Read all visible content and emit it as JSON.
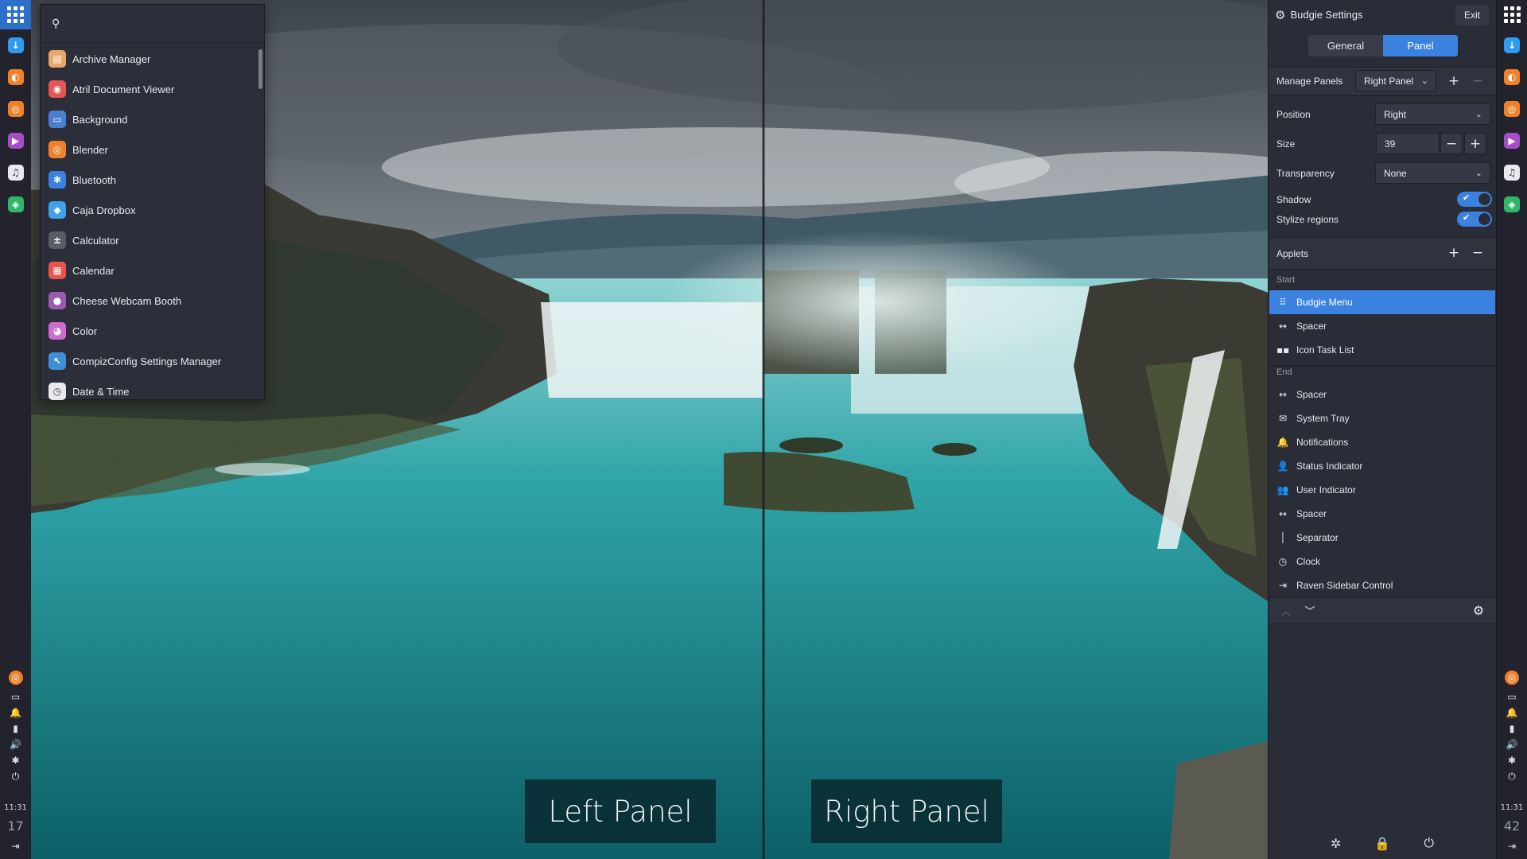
{
  "menu": {
    "search_placeholder": "",
    "items": [
      {
        "label": "Archive Manager",
        "icon": "archive-manager-icon",
        "color": "#e8a86a",
        "glyph": "▤"
      },
      {
        "label": "Atril Document Viewer",
        "icon": "atril-document-viewer-icon",
        "color": "#e25656",
        "glyph": "◉"
      },
      {
        "label": "Background",
        "icon": "background-icon",
        "color": "#4a7fd0",
        "glyph": "▭"
      },
      {
        "label": "Blender",
        "icon": "blender-icon",
        "color": "#f0812a",
        "glyph": "◎"
      },
      {
        "label": "Bluetooth",
        "icon": "bluetooth-icon",
        "color": "#3b82e0",
        "glyph": "✱"
      },
      {
        "label": "Caja Dropbox",
        "icon": "dropbox-icon",
        "color": "#3ea1ea",
        "glyph": "◆"
      },
      {
        "label": "Calculator",
        "icon": "calculator-icon",
        "color": "#5a5d66",
        "glyph": "±"
      },
      {
        "label": "Calendar",
        "icon": "calendar-icon",
        "color": "#e8554e",
        "glyph": "▦"
      },
      {
        "label": "Cheese Webcam Booth",
        "icon": "cheese-webcam-icon",
        "color": "#9a5bb0",
        "glyph": "●"
      },
      {
        "label": "Color",
        "icon": "color-icon",
        "color": "#d06ad0",
        "glyph": "◕"
      },
      {
        "label": "CompizConfig Settings Manager",
        "icon": "compizconfig-icon",
        "color": "#3e8fd6",
        "glyph": "↖"
      },
      {
        "label": "Date & Time",
        "icon": "date-time-icon",
        "color": "#e9e9ee",
        "glyph": "◷"
      }
    ]
  },
  "left_dock": {
    "apps": [
      {
        "icon": "download-manager-icon",
        "color": "#2f9bef",
        "glyph": "↓"
      },
      {
        "icon": "firefox-icon",
        "color": "#f0812a",
        "glyph": "◐"
      },
      {
        "icon": "blender-icon",
        "color": "#f0812a",
        "glyph": "◎"
      },
      {
        "icon": "media-player-icon",
        "color": "#a54fc6",
        "glyph": "▶"
      },
      {
        "icon": "music-icon",
        "color": "#e8e8ee",
        "glyph": "♫"
      },
      {
        "icon": "store-icon",
        "color": "#30b56a",
        "glyph": "◈"
      }
    ],
    "time_hour": "11:31",
    "time_min": "17"
  },
  "right_dock": {
    "time_hour": "11:31",
    "time_min": "42"
  },
  "labels": {
    "left_panel": "Left Panel",
    "right_panel": "Right Panel"
  },
  "settings": {
    "title": "Budgie Settings",
    "exit": "Exit",
    "tabs": [
      "General",
      "Panel"
    ],
    "selected_tab": "Panel",
    "manage_panels_label": "Manage Panels",
    "manage_panels_value": "Right Panel",
    "position_label": "Position",
    "position_value": "Right",
    "size_label": "Size",
    "size_value": "39",
    "transparency_label": "Transparency",
    "transparency_value": "None",
    "shadow_label": "Shadow",
    "shadow_on": true,
    "stylize_label": "Stylize regions",
    "stylize_on": true,
    "applets_label": "Applets",
    "start_label": "Start",
    "end_label": "End",
    "start_applets": [
      {
        "label": "Budgie Menu",
        "icon": "budgie-menu-icon",
        "glyph": "⠿",
        "selected": true
      },
      {
        "label": "Spacer",
        "icon": "spacer-icon",
        "glyph": "↔"
      },
      {
        "label": "Icon Task List",
        "icon": "icon-task-list-icon",
        "glyph": "▪▪"
      }
    ],
    "end_applets": [
      {
        "label": "Spacer",
        "icon": "spacer-icon",
        "glyph": "↔"
      },
      {
        "label": "System Tray",
        "icon": "system-tray-icon",
        "glyph": "✉"
      },
      {
        "label": "Notifications",
        "icon": "notifications-icon",
        "glyph": "🔔"
      },
      {
        "label": "Status Indicator",
        "icon": "status-indicator-icon",
        "glyph": "👤"
      },
      {
        "label": "User Indicator",
        "icon": "user-indicator-icon",
        "glyph": "👥"
      },
      {
        "label": "Spacer",
        "icon": "spacer-icon",
        "glyph": "↔"
      },
      {
        "label": "Separator",
        "icon": "separator-icon",
        "glyph": "│"
      },
      {
        "label": "Clock",
        "icon": "clock-icon",
        "glyph": "◷"
      },
      {
        "label": "Raven Sidebar Control",
        "icon": "raven-sidebar-control-icon",
        "glyph": "⇥"
      }
    ]
  },
  "colors": {
    "accent": "#3b82e0",
    "panel_bg": "#22232d",
    "settings_bg": "#2a2c37"
  }
}
